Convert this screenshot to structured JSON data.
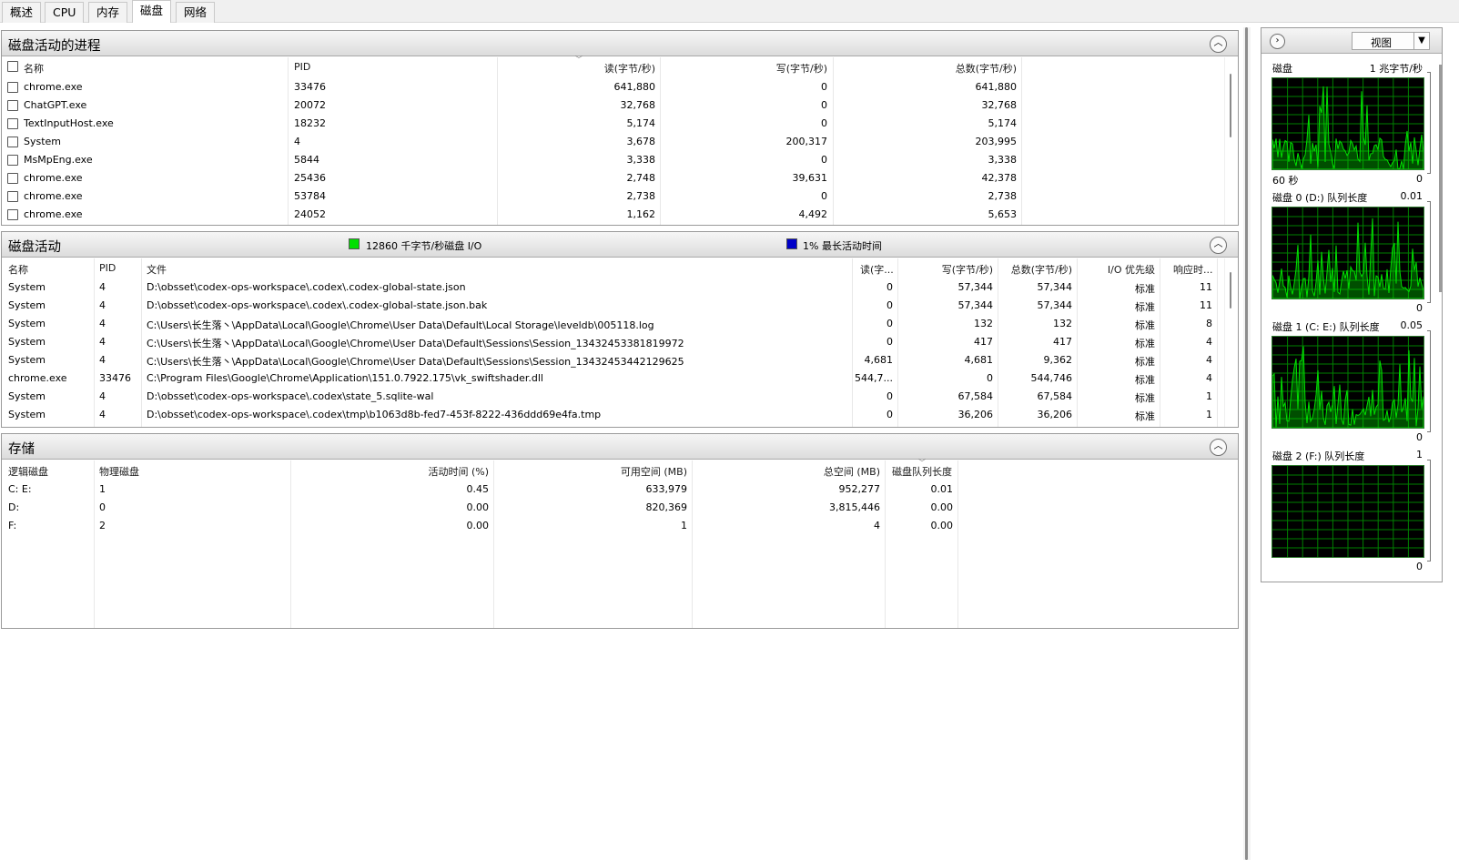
{
  "tabs": [
    "概述",
    "CPU",
    "内存",
    "磁盘",
    "网络"
  ],
  "active_tab": 3,
  "processes": {
    "title": "磁盘活动的进程",
    "collapse_icon": "chevron-up-icon",
    "columns": [
      "名称",
      "PID",
      "读(字节/秒)",
      "写(字节/秒)",
      "总数(字节/秒)"
    ],
    "rows": [
      {
        "name": "chrome.exe",
        "pid": "33476",
        "read": "641,880",
        "write": "0",
        "total": "641,880"
      },
      {
        "name": "ChatGPT.exe",
        "pid": "20072",
        "read": "32,768",
        "write": "0",
        "total": "32,768"
      },
      {
        "name": "TextInputHost.exe",
        "pid": "18232",
        "read": "5,174",
        "write": "0",
        "total": "5,174"
      },
      {
        "name": "System",
        "pid": "4",
        "read": "3,678",
        "write": "200,317",
        "total": "203,995"
      },
      {
        "name": "MsMpEng.exe",
        "pid": "5844",
        "read": "3,338",
        "write": "0",
        "total": "3,338"
      },
      {
        "name": "chrome.exe",
        "pid": "25436",
        "read": "2,748",
        "write": "39,631",
        "total": "42,378"
      },
      {
        "name": "chrome.exe",
        "pid": "53784",
        "read": "2,738",
        "write": "0",
        "total": "2,738"
      },
      {
        "name": "chrome.exe",
        "pid": "24052",
        "read": "1,162",
        "write": "4,492",
        "total": "5,653"
      }
    ]
  },
  "activity": {
    "title": "磁盘活动",
    "legend_io": "12860 千字节/秒磁盘 I/O",
    "legend_io_color": "#00e000",
    "legend_active": "1% 最长活动时间",
    "legend_active_color": "#0000c8",
    "columns": [
      "名称",
      "PID",
      "文件",
      "读(字...",
      "写(字节/秒)",
      "总数(字节/秒)",
      "I/O 优先级",
      "响应时..."
    ],
    "rows": [
      {
        "name": "System",
        "pid": "4",
        "file": "D:\\obsset\\codex-ops-workspace\\.codex\\.codex-global-state.json",
        "read": "0",
        "write": "57,344",
        "total": "57,344",
        "prio": "标准",
        "resp": "11"
      },
      {
        "name": "System",
        "pid": "4",
        "file": "D:\\obsset\\codex-ops-workspace\\.codex\\.codex-global-state.json.bak",
        "read": "0",
        "write": "57,344",
        "total": "57,344",
        "prio": "标准",
        "resp": "11"
      },
      {
        "name": "System",
        "pid": "4",
        "file": "C:\\Users\\长生落丶\\AppData\\Local\\Google\\Chrome\\User Data\\Default\\Local Storage\\leveldb\\005118.log",
        "read": "0",
        "write": "132",
        "total": "132",
        "prio": "标准",
        "resp": "8"
      },
      {
        "name": "System",
        "pid": "4",
        "file": "C:\\Users\\长生落丶\\AppData\\Local\\Google\\Chrome\\User Data\\Default\\Sessions\\Session_13432453381819972",
        "read": "0",
        "write": "417",
        "total": "417",
        "prio": "标准",
        "resp": "4"
      },
      {
        "name": "System",
        "pid": "4",
        "file": "C:\\Users\\长生落丶\\AppData\\Local\\Google\\Chrome\\User Data\\Default\\Sessions\\Session_13432453442129625",
        "read": "4,681",
        "write": "4,681",
        "total": "9,362",
        "prio": "标准",
        "resp": "4"
      },
      {
        "name": "chrome.exe",
        "pid": "33476",
        "file": "C:\\Program Files\\Google\\Chrome\\Application\\151.0.7922.175\\vk_swiftshader.dll",
        "read": "544,7...",
        "write": "0",
        "total": "544,746",
        "prio": "标准",
        "resp": "4"
      },
      {
        "name": "System",
        "pid": "4",
        "file": "D:\\obsset\\codex-ops-workspace\\.codex\\state_5.sqlite-wal",
        "read": "0",
        "write": "67,584",
        "total": "67,584",
        "prio": "标准",
        "resp": "1"
      },
      {
        "name": "System",
        "pid": "4",
        "file": "D:\\obsset\\codex-ops-workspace\\.codex\\tmp\\b1063d8b-fed7-453f-8222-436ddd69e4fa.tmp",
        "read": "0",
        "write": "36,206",
        "total": "36,206",
        "prio": "标准",
        "resp": "1"
      }
    ]
  },
  "storage": {
    "title": "存储",
    "columns": [
      "逻辑磁盘",
      "物理磁盘",
      "活动时间 (%)",
      "可用空间 (MB)",
      "总空间 (MB)",
      "磁盘队列长度"
    ],
    "rows": [
      {
        "logical": "C: E:",
        "physical": "1",
        "active": "0.45",
        "free": "633,979",
        "total": "952,277",
        "queue": "0.01"
      },
      {
        "logical": "D:",
        "physical": "0",
        "active": "0.00",
        "free": "820,369",
        "total": "3,815,446",
        "queue": "0.00"
      },
      {
        "logical": "F:",
        "physical": "2",
        "active": "0.00",
        "free": "1",
        "total": "4",
        "queue": "0.00"
      }
    ]
  },
  "side": {
    "view_label": "视图",
    "expand_icon": "chevron-right-icon",
    "dropdown_icon": "triangle-down-icon",
    "graphs": [
      {
        "title": "磁盘",
        "scale": "1 兆字节/秒",
        "footer_left": "60 秒",
        "footer_right": "0"
      },
      {
        "title": "磁盘 0 (D:) 队列长度",
        "scale": "0.01",
        "footer_left": "",
        "footer_right": "0"
      },
      {
        "title": "磁盘 1 (C: E:) 队列长度",
        "scale": "0.05",
        "footer_left": "",
        "footer_right": "0"
      },
      {
        "title": "磁盘 2 (F:) 队列长度",
        "scale": "1",
        "footer_left": "",
        "footer_right": "0"
      }
    ],
    "graph_color": "#00e000",
    "graph_grid_color": "#008000",
    "graph_bg": "#000000"
  }
}
